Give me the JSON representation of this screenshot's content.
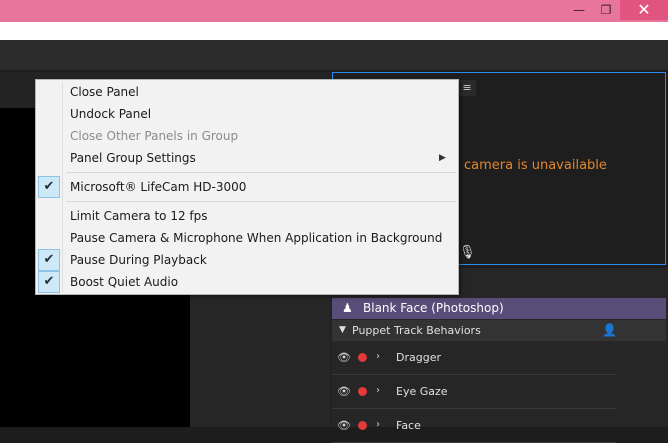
{
  "window": {
    "minimize_glyph": "—",
    "maximize_glyph": "❐",
    "close_glyph": "✕"
  },
  "camera_panel": {
    "menu_glyph": "≡",
    "status_text": "camera is unavailable",
    "mic_glyph": "🎙",
    "status_color": "#e0872f"
  },
  "puppet": {
    "icon_glyph": "♟",
    "name": "Blank Face (Photoshop)",
    "header_color": "#584c78"
  },
  "behaviors": {
    "header_label": "Puppet Track Behaviors",
    "header_chevron": "▼",
    "add_glyph": "👤",
    "items": [
      {
        "label": "Dragger",
        "eye": "👁",
        "chevron": "›"
      },
      {
        "label": "Eye Gaze",
        "eye": "👁",
        "chevron": "›"
      },
      {
        "label": "Face",
        "eye": "👁",
        "chevron": "›"
      }
    ]
  },
  "context_menu": {
    "check_glyph": "✔",
    "submenu_glyph": "▶",
    "items": [
      {
        "label": "Close Panel",
        "checked": false,
        "disabled": false
      },
      {
        "label": "Undock Panel",
        "checked": false,
        "disabled": false
      },
      {
        "label": "Close Other Panels in Group",
        "checked": false,
        "disabled": true
      },
      {
        "label": "Panel Group Settings",
        "checked": false,
        "disabled": false,
        "submenu": true
      },
      {
        "label": "Microsoft® LifeCam HD-3000",
        "checked": true,
        "disabled": false
      },
      {
        "label": "Limit Camera to 12 fps",
        "checked": false,
        "disabled": false
      },
      {
        "label": "Pause Camera & Microphone When Application in Background",
        "checked": false,
        "disabled": false
      },
      {
        "label": "Pause During Playback",
        "checked": true,
        "disabled": false
      },
      {
        "label": "Boost Quiet Audio",
        "checked": true,
        "disabled": false
      }
    ]
  }
}
